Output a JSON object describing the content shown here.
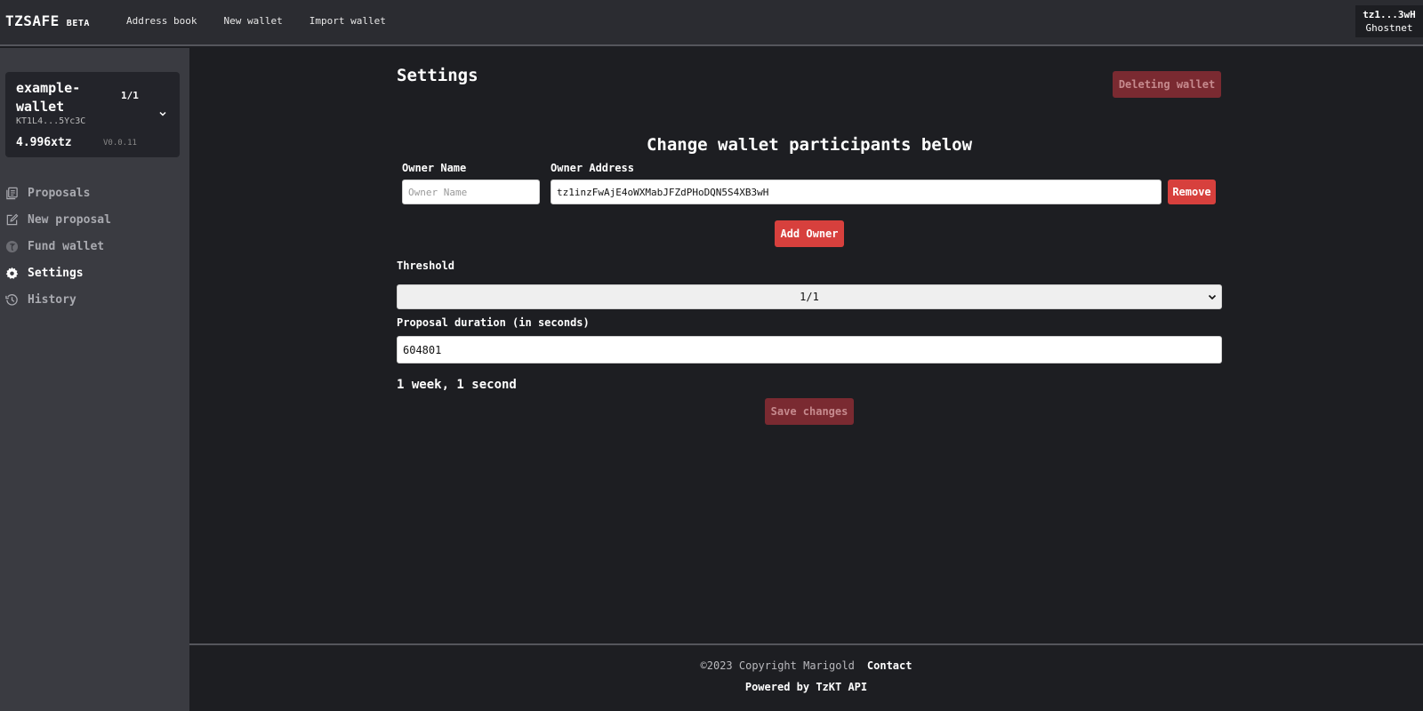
{
  "topbar": {
    "brand": "TZSAFE",
    "badge": "BETA",
    "nav": [
      "Address book",
      "New wallet",
      "Import wallet"
    ],
    "account_address": "tz1...3wH",
    "network": "Ghostnet"
  },
  "wallet": {
    "name": "example-wallet",
    "threshold": "1/1",
    "address": "KT1L4...5Yc3C",
    "balance": "4.996xtz",
    "version": "V0.0.11"
  },
  "sidebar": {
    "items": [
      {
        "label": "Proposals",
        "icon": "document-stack-icon",
        "active": false
      },
      {
        "label": "New proposal",
        "icon": "edit-icon",
        "active": false
      },
      {
        "label": "Fund wallet",
        "icon": "tezos-coin-icon",
        "active": false
      },
      {
        "label": "Settings",
        "icon": "gear-icon",
        "active": true
      },
      {
        "label": "History",
        "icon": "history-icon",
        "active": false
      }
    ]
  },
  "main": {
    "title": "Settings",
    "delete_button": "Deleting wallet",
    "section_title": "Change wallet participants below",
    "owner_name_label": "Owner Name",
    "owner_address_label": "Owner Address",
    "owner_name_placeholder": "Owner Name",
    "owner_name_value": "",
    "owner_address_value": "tz1inzFwAjE4oWXMabJFZdPHoDQN5S4XB3wH",
    "remove_button": "Remove",
    "add_owner_button": "Add Owner",
    "threshold_label": "Threshold",
    "threshold_value": "1/1",
    "duration_label": "Proposal duration (in seconds)",
    "duration_value": "604801",
    "duration_text": "1 week, 1 second",
    "save_button": "Save changes"
  },
  "footer": {
    "copyright": "©2023 Copyright Marigold",
    "contact": "Contact",
    "powered": "Powered by TzKT API"
  },
  "colors": {
    "accent_red": "#d7403d",
    "background": "#1d1e22",
    "sidebar": "#3a3b41"
  }
}
